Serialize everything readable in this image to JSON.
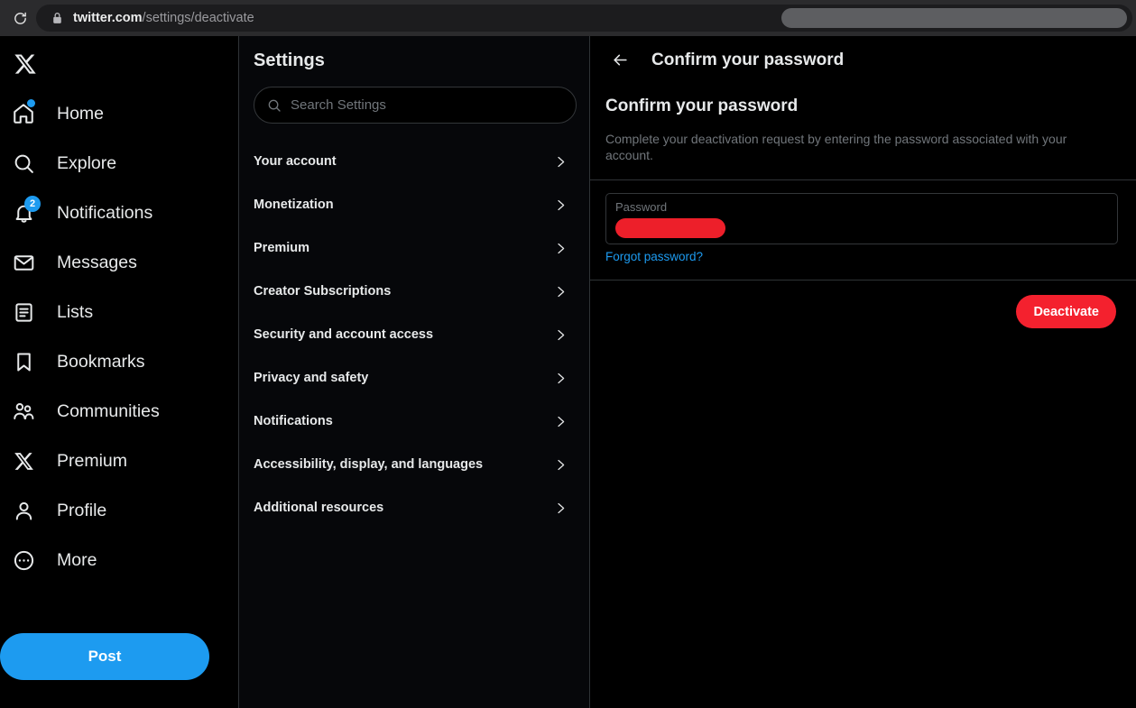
{
  "browser": {
    "reload_icon": "reload-icon",
    "lock_icon": "lock-icon",
    "url_domain": "twitter.com",
    "url_path": "/settings/deactivate",
    "url_full": "twitter.com/settings/deactivate"
  },
  "nav": {
    "brand_icon": "x-logo-icon",
    "items": [
      {
        "label": "Home",
        "icon": "home-icon",
        "badge_dot": true
      },
      {
        "label": "Explore",
        "icon": "search-icon"
      },
      {
        "label": "Notifications",
        "icon": "bell-icon",
        "badge_count": "2"
      },
      {
        "label": "Messages",
        "icon": "envelope-icon"
      },
      {
        "label": "Lists",
        "icon": "list-icon"
      },
      {
        "label": "Bookmarks",
        "icon": "bookmark-icon"
      },
      {
        "label": "Communities",
        "icon": "people-icon"
      },
      {
        "label": "Premium",
        "icon": "x-logo-icon"
      },
      {
        "label": "Profile",
        "icon": "person-icon"
      },
      {
        "label": "More",
        "icon": "more-circle-icon"
      }
    ],
    "post_label": "Post"
  },
  "settings": {
    "title": "Settings",
    "search_placeholder": "Search Settings",
    "search_value": "",
    "search_icon": "search-icon",
    "items": [
      {
        "label": "Your account"
      },
      {
        "label": "Monetization"
      },
      {
        "label": "Premium"
      },
      {
        "label": "Creator Subscriptions"
      },
      {
        "label": "Security and account access"
      },
      {
        "label": "Privacy and safety"
      },
      {
        "label": "Notifications"
      },
      {
        "label": "Accessibility, display, and languages"
      },
      {
        "label": "Additional resources"
      }
    ]
  },
  "detail": {
    "back_icon": "back-arrow-icon",
    "header_title": "Confirm your password",
    "heading": "Confirm your password",
    "description": "Complete your deactivation request by entering the password associated with your account.",
    "password_label": "Password",
    "password_value": "",
    "forgot_label": "Forgot password?",
    "deactivate_label": "Deactivate",
    "annotation_icon": "up-arrow-annotation-icon"
  },
  "colors": {
    "accent_blue": "#1d9bf0",
    "danger_red": "#f4212e",
    "redaction_red": "#ed1f2a",
    "redaction_gray": "#5d5e61",
    "text_primary": "#e7e9ea",
    "text_secondary": "#71767b",
    "border": "#2f3336"
  }
}
